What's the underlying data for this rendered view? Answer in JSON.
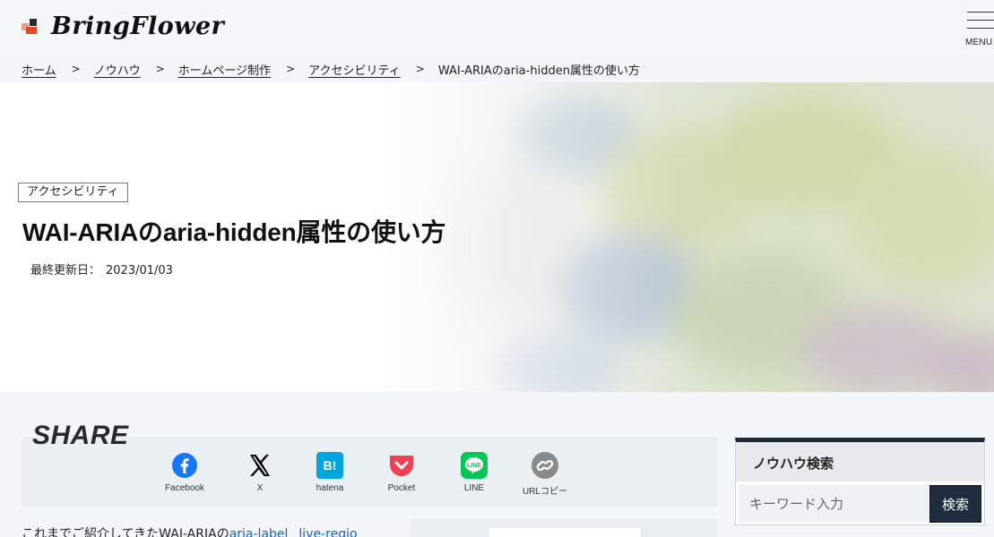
{
  "site": {
    "logo_text": "BringFlower",
    "menu_label": "MENU",
    "logo_colors": [
      "#e04b2b",
      "#f29a8a",
      "#2b2b2b"
    ]
  },
  "breadcrumb": {
    "items": [
      "ホーム",
      "ノウハウ",
      "ホームページ制作",
      "アクセシビリティ"
    ],
    "current": "WAI-ARIAのaria-hidden属性の使い方",
    "separator": ">"
  },
  "article": {
    "category": "アクセシビリティ",
    "title": "WAI-ARIAのaria-hidden属性の使い方",
    "updated_label": "最終更新日：",
    "updated_date": "2023/01/03",
    "intro_text": "これまでご紹介してきたWAI-ARIAの",
    "intro_link1": "aria-label",
    "intro_link2": "live-regio"
  },
  "share": {
    "title": "SHARE",
    "items": [
      {
        "label": "Facebook",
        "icon": "facebook-icon",
        "color": "#1877f2"
      },
      {
        "label": "X",
        "icon": "x-icon",
        "color": "#000000"
      },
      {
        "label": "hatena",
        "icon": "hatena-icon",
        "color": "#00a4de"
      },
      {
        "label": "Pocket",
        "icon": "pocket-icon",
        "color": "#ef4056"
      },
      {
        "label": "LINE",
        "icon": "line-icon",
        "color": "#06c755"
      },
      {
        "label": "URLコピー",
        "icon": "link-icon",
        "color": "#8a8a8a"
      }
    ]
  },
  "sidebar": {
    "search_title": "ノウハウ検索",
    "search_placeholder": "キーワード入力",
    "search_button": "検索",
    "accent_color": "#1e2c3e"
  }
}
